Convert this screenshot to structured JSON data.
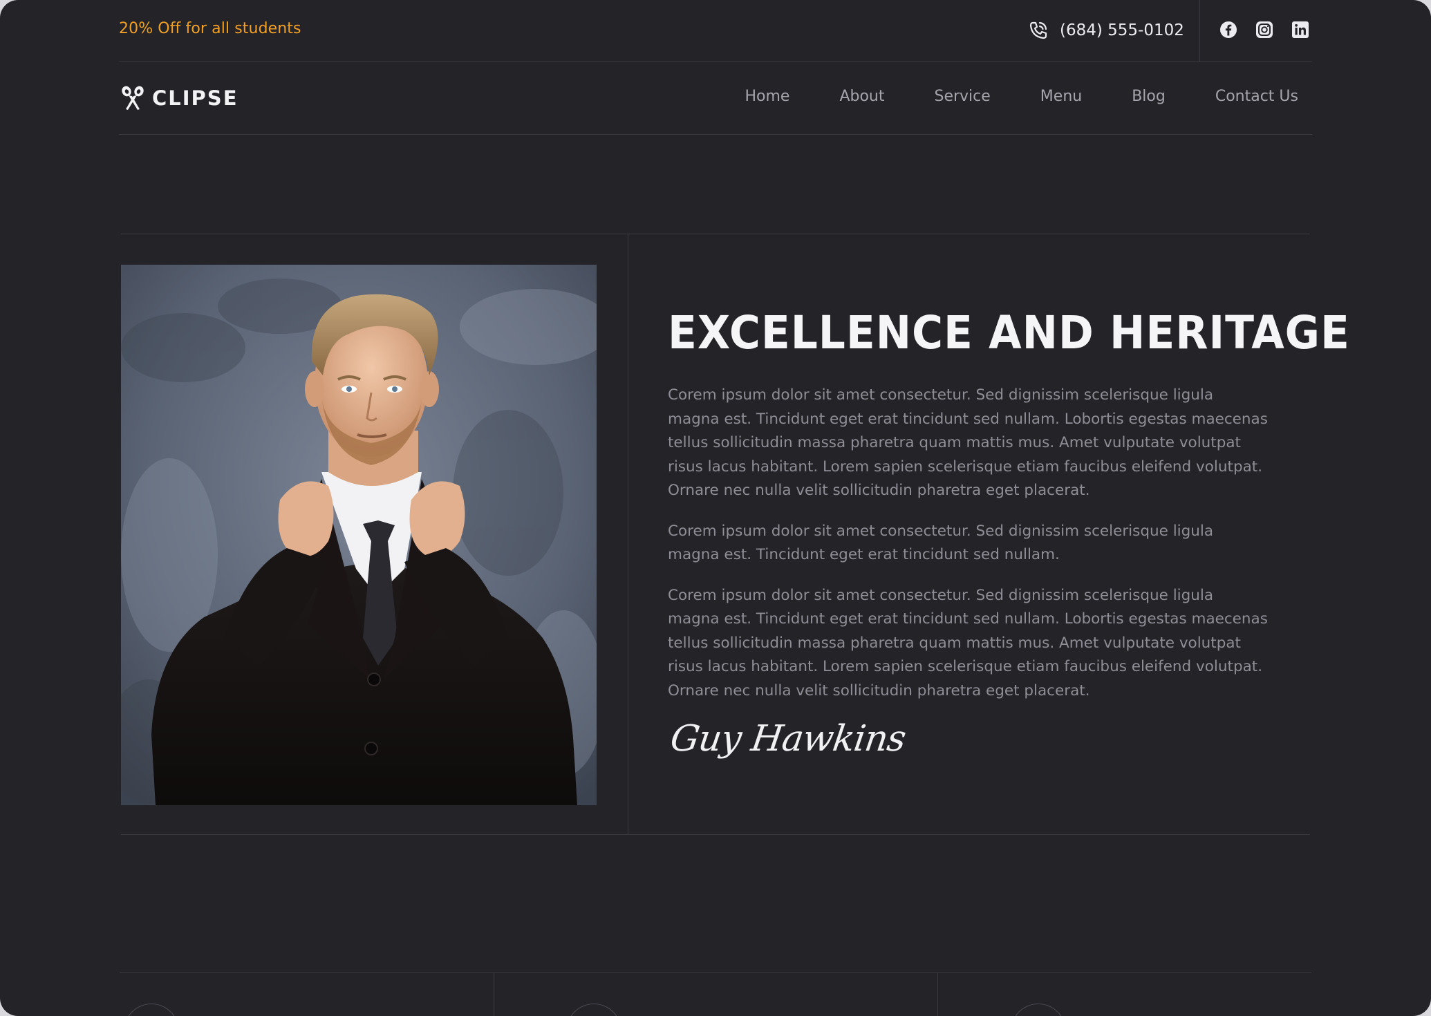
{
  "topbar": {
    "promo": "20% Off for all students",
    "phone": "(684) 555-0102",
    "socials": [
      {
        "icon": "facebook-icon"
      },
      {
        "icon": "instagram-icon"
      },
      {
        "icon": "linkedin-icon"
      }
    ]
  },
  "brand": {
    "name": "CLIPSE",
    "icon": "scissors-icon"
  },
  "nav": {
    "items": [
      "Home",
      "About",
      "Service",
      "Menu",
      "Blog",
      "Contact Us"
    ]
  },
  "story": {
    "title": "EXCELLENCE AND HERITAGE",
    "paragraphs": [
      "Corem ipsum dolor sit amet consectetur. Sed dignissim scelerisque ligula magna est. Tincidunt eget erat tincidunt sed nullam. Lobortis egestas maecenas tellus sollicitudin massa pharetra quam mattis mus. Amet vulputate volutpat risus lacus habitant. Lorem sapien scelerisque etiam faucibus eleifend volutpat. Ornare nec nulla velit sollicitudin pharetra eget placerat.",
      "Corem ipsum dolor sit amet consectetur. Sed dignissim scelerisque ligula magna est. Tincidunt eget erat tincidunt sed nullam.",
      "Corem ipsum dolor sit amet consectetur. Sed dignissim scelerisque ligula magna est. Tincidunt eget erat tincidunt sed nullam. Lobortis egestas maecenas tellus sollicitudin massa pharetra quam mattis mus. Amet vulputate volutpat risus lacus habitant. Lorem sapien scelerisque etiam faucibus eleifend volutpat. Ornare nec nulla velit sollicitudin pharetra eget placerat."
    ],
    "signature": "Guy Hawkins"
  },
  "colors": {
    "background": "#242328",
    "accent": "#f2a023",
    "divider": "#3b3a41",
    "body_text": "#8f8e96",
    "nav_text": "#a6a5ad",
    "heading": "#f5f5f8"
  }
}
